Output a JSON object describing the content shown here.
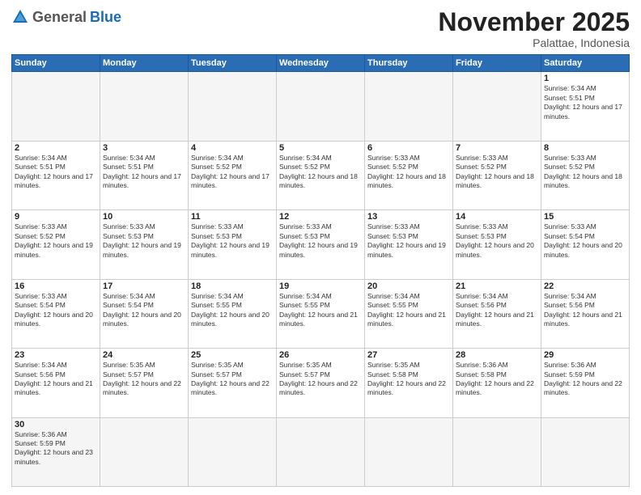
{
  "header": {
    "logo_general": "General",
    "logo_blue": "Blue",
    "month_title": "November 2025",
    "subtitle": "Palattae, Indonesia"
  },
  "weekdays": [
    "Sunday",
    "Monday",
    "Tuesday",
    "Wednesday",
    "Thursday",
    "Friday",
    "Saturday"
  ],
  "days": [
    {
      "num": "",
      "empty": true,
      "sunrise": "",
      "sunset": "",
      "daylight": ""
    },
    {
      "num": "",
      "empty": true,
      "sunrise": "",
      "sunset": "",
      "daylight": ""
    },
    {
      "num": "",
      "empty": true,
      "sunrise": "",
      "sunset": "",
      "daylight": ""
    },
    {
      "num": "",
      "empty": true,
      "sunrise": "",
      "sunset": "",
      "daylight": ""
    },
    {
      "num": "",
      "empty": true,
      "sunrise": "",
      "sunset": "",
      "daylight": ""
    },
    {
      "num": "",
      "empty": true,
      "sunrise": "",
      "sunset": "",
      "daylight": ""
    },
    {
      "num": "1",
      "sunrise": "Sunrise: 5:34 AM",
      "sunset": "Sunset: 5:51 PM",
      "daylight": "Daylight: 12 hours and 17 minutes."
    },
    {
      "num": "2",
      "sunrise": "Sunrise: 5:34 AM",
      "sunset": "Sunset: 5:51 PM",
      "daylight": "Daylight: 12 hours and 17 minutes."
    },
    {
      "num": "3",
      "sunrise": "Sunrise: 5:34 AM",
      "sunset": "Sunset: 5:51 PM",
      "daylight": "Daylight: 12 hours and 17 minutes."
    },
    {
      "num": "4",
      "sunrise": "Sunrise: 5:34 AM",
      "sunset": "Sunset: 5:52 PM",
      "daylight": "Daylight: 12 hours and 17 minutes."
    },
    {
      "num": "5",
      "sunrise": "Sunrise: 5:34 AM",
      "sunset": "Sunset: 5:52 PM",
      "daylight": "Daylight: 12 hours and 18 minutes."
    },
    {
      "num": "6",
      "sunrise": "Sunrise: 5:33 AM",
      "sunset": "Sunset: 5:52 PM",
      "daylight": "Daylight: 12 hours and 18 minutes."
    },
    {
      "num": "7",
      "sunrise": "Sunrise: 5:33 AM",
      "sunset": "Sunset: 5:52 PM",
      "daylight": "Daylight: 12 hours and 18 minutes."
    },
    {
      "num": "8",
      "sunrise": "Sunrise: 5:33 AM",
      "sunset": "Sunset: 5:52 PM",
      "daylight": "Daylight: 12 hours and 18 minutes."
    },
    {
      "num": "9",
      "sunrise": "Sunrise: 5:33 AM",
      "sunset": "Sunset: 5:52 PM",
      "daylight": "Daylight: 12 hours and 19 minutes."
    },
    {
      "num": "10",
      "sunrise": "Sunrise: 5:33 AM",
      "sunset": "Sunset: 5:53 PM",
      "daylight": "Daylight: 12 hours and 19 minutes."
    },
    {
      "num": "11",
      "sunrise": "Sunrise: 5:33 AM",
      "sunset": "Sunset: 5:53 PM",
      "daylight": "Daylight: 12 hours and 19 minutes."
    },
    {
      "num": "12",
      "sunrise": "Sunrise: 5:33 AM",
      "sunset": "Sunset: 5:53 PM",
      "daylight": "Daylight: 12 hours and 19 minutes."
    },
    {
      "num": "13",
      "sunrise": "Sunrise: 5:33 AM",
      "sunset": "Sunset: 5:53 PM",
      "daylight": "Daylight: 12 hours and 19 minutes."
    },
    {
      "num": "14",
      "sunrise": "Sunrise: 5:33 AM",
      "sunset": "Sunset: 5:53 PM",
      "daylight": "Daylight: 12 hours and 20 minutes."
    },
    {
      "num": "15",
      "sunrise": "Sunrise: 5:33 AM",
      "sunset": "Sunset: 5:54 PM",
      "daylight": "Daylight: 12 hours and 20 minutes."
    },
    {
      "num": "16",
      "sunrise": "Sunrise: 5:33 AM",
      "sunset": "Sunset: 5:54 PM",
      "daylight": "Daylight: 12 hours and 20 minutes."
    },
    {
      "num": "17",
      "sunrise": "Sunrise: 5:34 AM",
      "sunset": "Sunset: 5:54 PM",
      "daylight": "Daylight: 12 hours and 20 minutes."
    },
    {
      "num": "18",
      "sunrise": "Sunrise: 5:34 AM",
      "sunset": "Sunset: 5:55 PM",
      "daylight": "Daylight: 12 hours and 20 minutes."
    },
    {
      "num": "19",
      "sunrise": "Sunrise: 5:34 AM",
      "sunset": "Sunset: 5:55 PM",
      "daylight": "Daylight: 12 hours and 21 minutes."
    },
    {
      "num": "20",
      "sunrise": "Sunrise: 5:34 AM",
      "sunset": "Sunset: 5:55 PM",
      "daylight": "Daylight: 12 hours and 21 minutes."
    },
    {
      "num": "21",
      "sunrise": "Sunrise: 5:34 AM",
      "sunset": "Sunset: 5:56 PM",
      "daylight": "Daylight: 12 hours and 21 minutes."
    },
    {
      "num": "22",
      "sunrise": "Sunrise: 5:34 AM",
      "sunset": "Sunset: 5:56 PM",
      "daylight": "Daylight: 12 hours and 21 minutes."
    },
    {
      "num": "23",
      "sunrise": "Sunrise: 5:34 AM",
      "sunset": "Sunset: 5:56 PM",
      "daylight": "Daylight: 12 hours and 21 minutes."
    },
    {
      "num": "24",
      "sunrise": "Sunrise: 5:35 AM",
      "sunset": "Sunset: 5:57 PM",
      "daylight": "Daylight: 12 hours and 22 minutes."
    },
    {
      "num": "25",
      "sunrise": "Sunrise: 5:35 AM",
      "sunset": "Sunset: 5:57 PM",
      "daylight": "Daylight: 12 hours and 22 minutes."
    },
    {
      "num": "26",
      "sunrise": "Sunrise: 5:35 AM",
      "sunset": "Sunset: 5:57 PM",
      "daylight": "Daylight: 12 hours and 22 minutes."
    },
    {
      "num": "27",
      "sunrise": "Sunrise: 5:35 AM",
      "sunset": "Sunset: 5:58 PM",
      "daylight": "Daylight: 12 hours and 22 minutes."
    },
    {
      "num": "28",
      "sunrise": "Sunrise: 5:36 AM",
      "sunset": "Sunset: 5:58 PM",
      "daylight": "Daylight: 12 hours and 22 minutes."
    },
    {
      "num": "29",
      "sunrise": "Sunrise: 5:36 AM",
      "sunset": "Sunset: 5:59 PM",
      "daylight": "Daylight: 12 hours and 22 minutes."
    },
    {
      "num": "30",
      "sunrise": "Sunrise: 5:36 AM",
      "sunset": "Sunset: 5:59 PM",
      "daylight": "Daylight: 12 hours and 23 minutes."
    }
  ]
}
